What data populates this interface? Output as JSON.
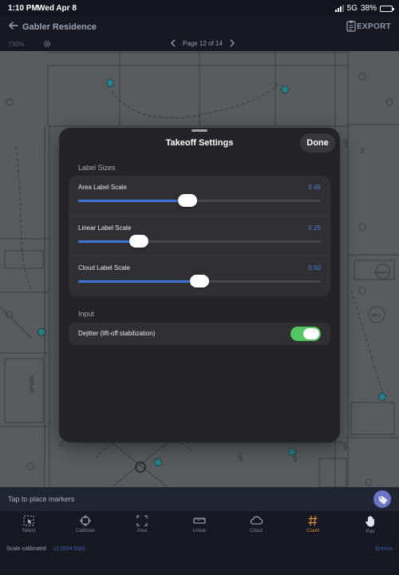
{
  "status_bar": {
    "time": "1:10 PM",
    "date": "Wed Apr 8",
    "network": "5G",
    "battery": "38%",
    "battery_level": 0.38
  },
  "header": {
    "back_icon": "arrow-left-icon",
    "title": "Gabler Residence",
    "clipboard_icon": "clipboard-icon",
    "export_label": "EXPORT"
  },
  "toolbar": {
    "zoom": "730%",
    "settings_icon": "gear-icon",
    "page_label": "Page 12 of 14"
  },
  "canvas": {
    "plan_labels": [
      "TV",
      "GFI/220",
      "TV",
      "GFI",
      "GFI",
      "GFI",
      "GFI",
      "CM/SD-1",
      "SD-1"
    ],
    "accent_marker": "#2a7d86"
  },
  "modal": {
    "title": "Takeoff Settings",
    "done_label": "Done",
    "label_sizes_section": "Label Sizes",
    "sliders": [
      {
        "label": "Area Label Scale",
        "value_text": "0.45",
        "value": 0.45
      },
      {
        "label": "Linear Label Scale",
        "value_text": "0.25",
        "value": 0.25
      },
      {
        "label": "Cloud Label Scale",
        "value_text": "0.50",
        "value": 0.5
      }
    ],
    "slider_range": [
      0,
      1
    ],
    "input_section": "Input",
    "toggle": {
      "label": "Dejitter (lift-off stabilization)",
      "on": true
    },
    "colors": {
      "accent": "#3d76d8",
      "toggle_on": "#53c563"
    }
  },
  "hint_bar": {
    "text": "Tap to place markers",
    "tag_icon": "tag-icon"
  },
  "tools": [
    {
      "label": "Select",
      "icon": "select-icon",
      "active": false
    },
    {
      "label": "Calibrate",
      "icon": "crosshair-icon",
      "active": false
    },
    {
      "label": "Area",
      "icon": "area-icon",
      "active": false
    },
    {
      "label": "Linear",
      "icon": "ruler-icon",
      "active": false
    },
    {
      "label": "Cloud",
      "icon": "cloud-icon",
      "active": false
    },
    {
      "label": "Count",
      "icon": "hash-icon",
      "active": true
    },
    {
      "label": "Pan",
      "icon": "hand-icon",
      "active": false
    }
  ],
  "footer": {
    "calibration_status": "Scale calibrated",
    "calibration_value": "(0.0554 ft/pt)",
    "entries_label": "Entries"
  }
}
